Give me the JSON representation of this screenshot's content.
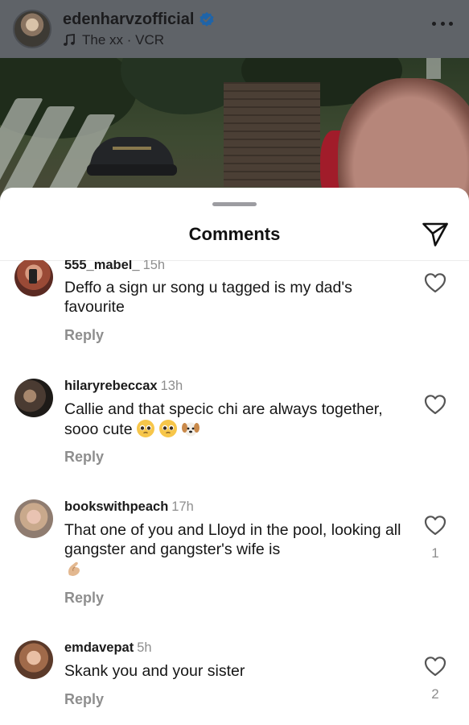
{
  "post": {
    "username": "edenharvzofficial",
    "audio": "The xx · VCR",
    "icons": {
      "verified": "verified-badge-icon",
      "audio": "music-note-icon",
      "more": "more-options-icon"
    }
  },
  "sheet": {
    "title": "Comments",
    "share_icon": "paper-plane-icon"
  },
  "comments": [
    {
      "username": "555_mabel_",
      "time": "15h",
      "text": "Deffo a sign ur song u tagged is my dad's favourite",
      "reply": "Reply",
      "likes": ""
    },
    {
      "username": "hilaryrebeccax",
      "time": "13h",
      "text": "Callie and that specic chi are always together, sooo cute",
      "emojis": [
        "pleading-face-emoji",
        "pleading-face-emoji",
        "dog-face-emoji"
      ],
      "reply": "Reply",
      "likes": ""
    },
    {
      "username": "bookswithpeach",
      "time": "17h",
      "text": "That one of you and Lloyd in the pool, looking all gangster and gangster's wife is",
      "emojis": [
        "pinched-fingers-emoji"
      ],
      "reply": "Reply",
      "likes": "1"
    },
    {
      "username": "emdavepat",
      "time": "5h",
      "text": "Skank you and your sister",
      "reply": "Reply",
      "likes": "2"
    }
  ],
  "colors": {
    "header_bg": "#5f6368",
    "verified": "#3897f0",
    "muted_text": "#8e8e8e"
  }
}
